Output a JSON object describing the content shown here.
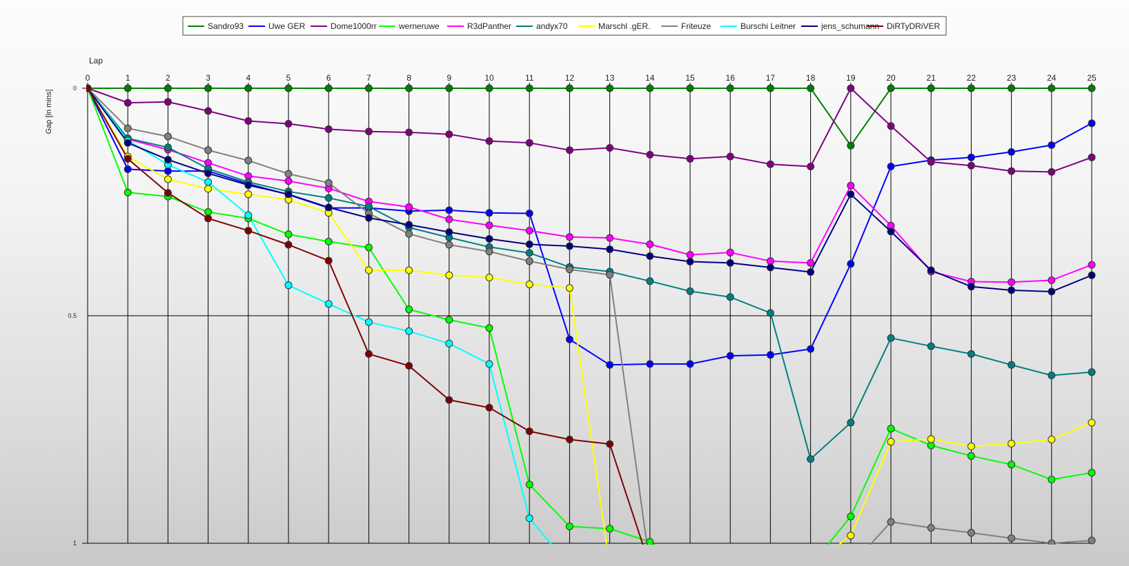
{
  "chart_data": {
    "type": "line",
    "xlabel": "Lap",
    "ylabel": "Gap [in mins]",
    "x": [
      0,
      1,
      2,
      3,
      4,
      5,
      6,
      7,
      8,
      9,
      10,
      11,
      12,
      13,
      14,
      15,
      16,
      17,
      18,
      19,
      20,
      21,
      22,
      23,
      24,
      25
    ],
    "ylim": [
      0,
      1
    ],
    "y_inverted": true,
    "yticks": [
      "0",
      "0.5",
      "1"
    ],
    "grid": "vertical lines at every lap, horizontal line at 0.5",
    "legend_position": "top",
    "series": [
      {
        "name": "Sandro93",
        "color": "#008000",
        "values": [
          0,
          0,
          0,
          0,
          0,
          0,
          0,
          0,
          0,
          0,
          0,
          0,
          0,
          0,
          0,
          0,
          0,
          0,
          0,
          0.126,
          0,
          0,
          0,
          0,
          0,
          0
        ]
      },
      {
        "name": "Uwe GER",
        "color": "#0000ff",
        "values": [
          0,
          0.178,
          0.182,
          0.182,
          0.21,
          0.234,
          0.263,
          0.263,
          0.27,
          0.268,
          0.274,
          0.275,
          0.552,
          0.608,
          0.606,
          0.606,
          0.588,
          0.586,
          0.573,
          0.386,
          0.172,
          0.158,
          0.152,
          0.14,
          0.125,
          0.077
        ]
      },
      {
        "name": "Dome1000rr",
        "color": "#800080",
        "values": [
          0,
          0.032,
          0.03,
          0.05,
          0.072,
          0.078,
          0.09,
          0.095,
          0.097,
          0.101,
          0.116,
          0.12,
          0.136,
          0.131,
          0.146,
          0.155,
          0.15,
          0.167,
          0.172,
          0,
          0.083,
          0.162,
          0.17,
          0.182,
          0.184,
          0.152
        ]
      },
      {
        "name": "werneruwe",
        "color": "#00ff00",
        "values": [
          0,
          0.229,
          0.238,
          0.272,
          0.286,
          0.321,
          0.337,
          0.35,
          0.486,
          0.509,
          0.527,
          0.871,
          0.963,
          0.968,
          0.997,
          1.05,
          1.05,
          1.05,
          1.05,
          0.941,
          0.748,
          0.785,
          0.808,
          0.827,
          0.86,
          0.845
        ]
      },
      {
        "name": "R3dPanther",
        "color": "#ff00ff",
        "values": [
          0,
          0.112,
          0.135,
          0.164,
          0.193,
          0.204,
          0.22,
          0.249,
          0.261,
          0.288,
          0.301,
          0.313,
          0.327,
          0.329,
          0.343,
          0.366,
          0.361,
          0.38,
          0.384,
          0.214,
          0.302,
          0.403,
          0.425,
          0.426,
          0.422,
          0.388
        ]
      },
      {
        "name": "andyx70",
        "color": "#008080",
        "values": [
          0,
          0.11,
          0.13,
          0.177,
          0.206,
          0.227,
          0.241,
          0.26,
          0.306,
          0.328,
          0.349,
          0.362,
          0.393,
          0.403,
          0.424,
          0.446,
          0.459,
          0.494,
          0.815,
          0.735,
          0.549,
          0.567,
          0.584,
          0.608,
          0.631,
          0.624
        ]
      },
      {
        "name": "Marschl .gER.",
        "color": "#ffff00",
        "values": [
          0,
          0.15,
          0.2,
          0.221,
          0.233,
          0.245,
          0.274,
          0.4,
          0.4,
          0.411,
          0.416,
          0.431,
          0.439,
          1.05,
          1.05,
          1.05,
          1.05,
          1.05,
          1.05,
          0.983,
          0.777,
          0.771,
          0.787,
          0.781,
          0.772,
          0.735
        ]
      },
      {
        "name": "Friteuze",
        "color": "#808080",
        "values": [
          0,
          0.088,
          0.106,
          0.136,
          0.159,
          0.188,
          0.208,
          0.275,
          0.32,
          0.344,
          0.359,
          0.38,
          0.398,
          0.41,
          1.05,
          1.05,
          1.05,
          1.05,
          1.05,
          1.05,
          0.953,
          0.966,
          0.977,
          0.989,
          1.0,
          0.994
        ]
      },
      {
        "name": "Burschi Leitner",
        "color": "#00ffff",
        "values": [
          0,
          0.115,
          0.168,
          0.206,
          0.279,
          0.433,
          0.474,
          0.514,
          0.534,
          0.561,
          0.606,
          0.945,
          1.05,
          1.05,
          1.05,
          1.05,
          1.05,
          1.05,
          1.05,
          1.05,
          1.05,
          1.05,
          1.05,
          1.05,
          1.05,
          1.05
        ]
      },
      {
        "name": "jens_schumann",
        "color": "#000080",
        "values": [
          0,
          0.12,
          0.157,
          0.187,
          0.213,
          0.233,
          0.262,
          0.285,
          0.3,
          0.316,
          0.331,
          0.343,
          0.347,
          0.354,
          0.369,
          0.381,
          0.384,
          0.394,
          0.404,
          0.233,
          0.315,
          0.4,
          0.436,
          0.444,
          0.447,
          0.411
        ]
      },
      {
        "name": "DiRTyDRiVER",
        "color": "#800000",
        "values": [
          0,
          0.155,
          0.23,
          0.286,
          0.313,
          0.344,
          0.379,
          0.584,
          0.61,
          0.685,
          0.702,
          0.754,
          0.772,
          0.782,
          1.05,
          1.05,
          1.05,
          1.05,
          1.05,
          1.05,
          1.05,
          1.05,
          1.05,
          1.05,
          1.05,
          1.05
        ]
      }
    ]
  }
}
